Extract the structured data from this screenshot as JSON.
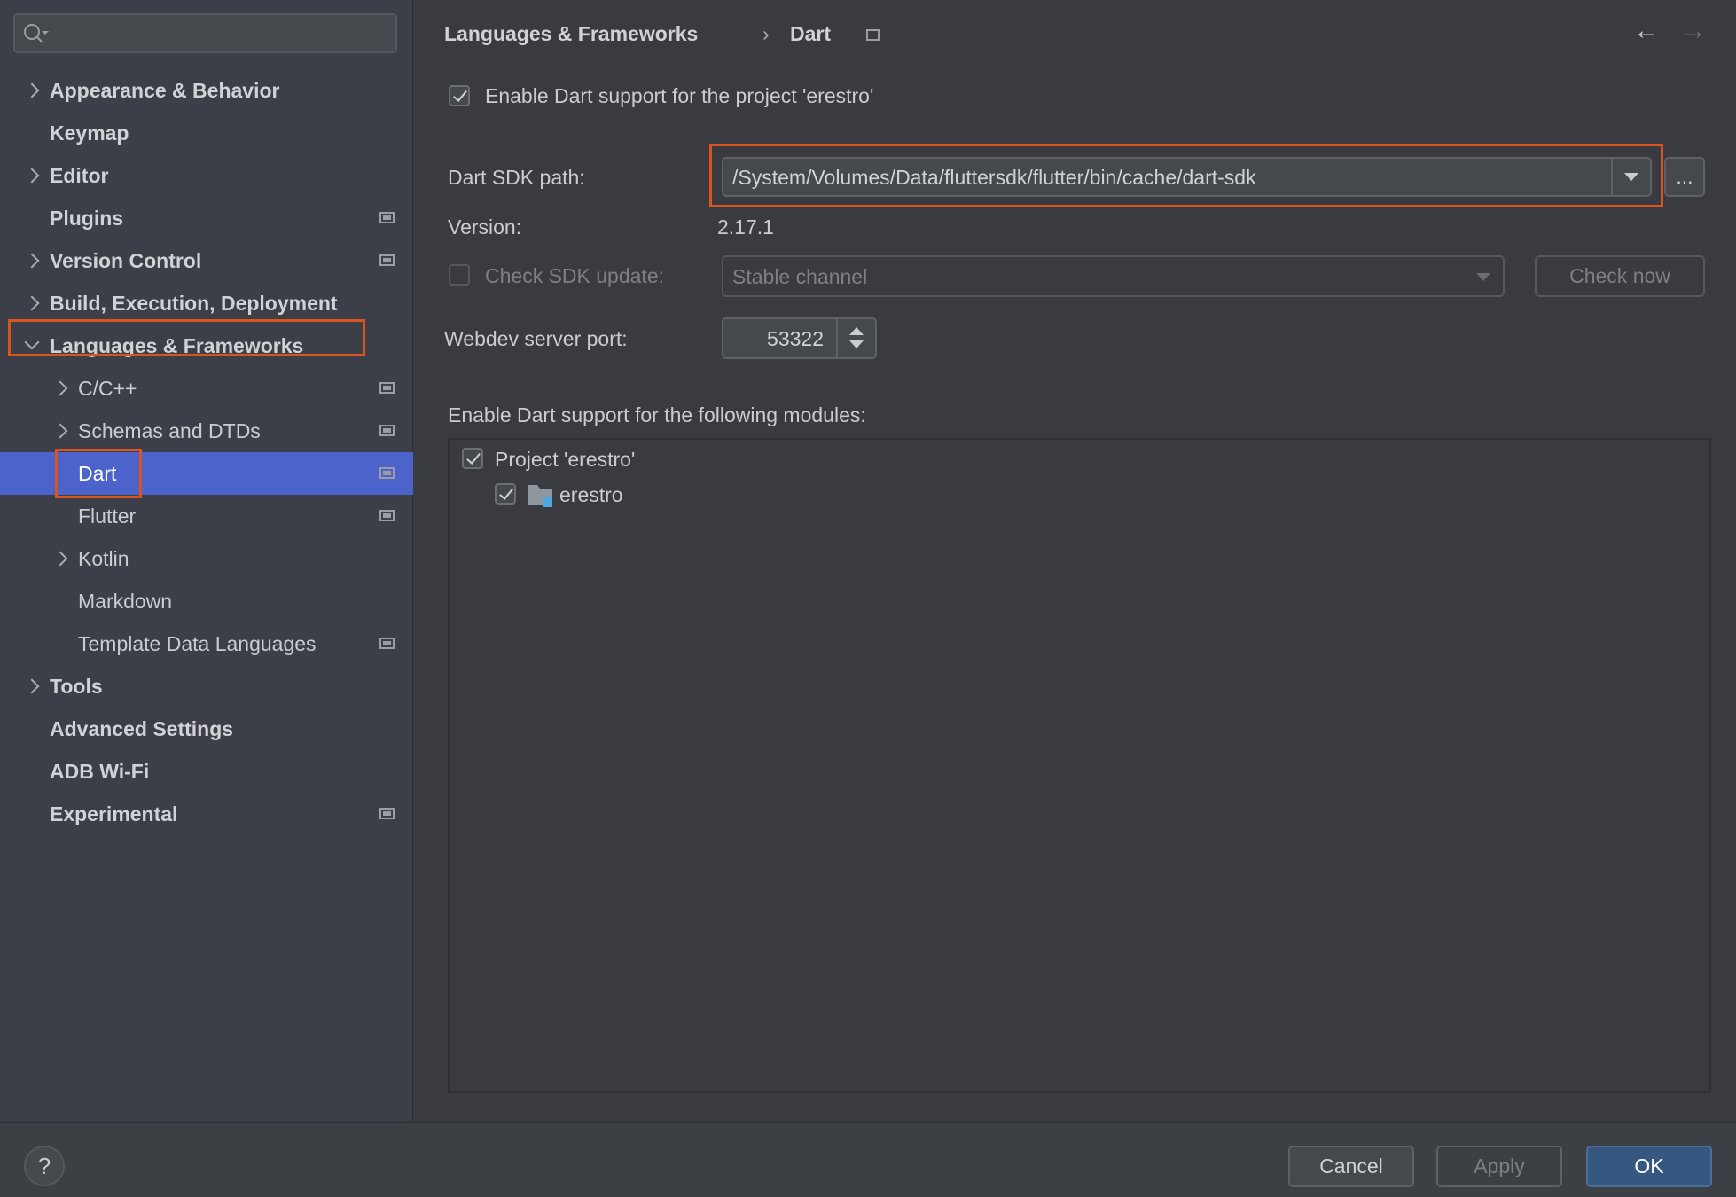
{
  "search": {
    "placeholder": ""
  },
  "sidebar": {
    "items": [
      {
        "label": "Appearance & Behavior",
        "level": 0,
        "bold": true,
        "chevron": "right",
        "settings": false
      },
      {
        "label": "Keymap",
        "level": 0,
        "bold": true,
        "chevron": null,
        "settings": false
      },
      {
        "label": "Editor",
        "level": 0,
        "bold": true,
        "chevron": "right",
        "settings": false
      },
      {
        "label": "Plugins",
        "level": 0,
        "bold": true,
        "chevron": null,
        "settings": true
      },
      {
        "label": "Version Control",
        "level": 0,
        "bold": true,
        "chevron": "right",
        "settings": true
      },
      {
        "label": "Build, Execution, Deployment",
        "level": 0,
        "bold": true,
        "chevron": "right",
        "settings": false
      },
      {
        "label": "Languages & Frameworks",
        "level": 0,
        "bold": true,
        "chevron": "down",
        "settings": false,
        "highlighted": true
      },
      {
        "label": "C/C++",
        "level": 1,
        "bold": false,
        "chevron": "right",
        "settings": true
      },
      {
        "label": "Schemas and DTDs",
        "level": 1,
        "bold": false,
        "chevron": "right",
        "settings": true
      },
      {
        "label": "Dart",
        "level": 1,
        "bold": false,
        "chevron": null,
        "settings": true,
        "selected": true,
        "highlighted": true
      },
      {
        "label": "Flutter",
        "level": 1,
        "bold": false,
        "chevron": null,
        "settings": true
      },
      {
        "label": "Kotlin",
        "level": 1,
        "bold": false,
        "chevron": "right",
        "settings": false
      },
      {
        "label": "Markdown",
        "level": 1,
        "bold": false,
        "chevron": null,
        "settings": false
      },
      {
        "label": "Template Data Languages",
        "level": 1,
        "bold": false,
        "chevron": null,
        "settings": true
      },
      {
        "label": "Tools",
        "level": 0,
        "bold": true,
        "chevron": "right",
        "settings": false
      },
      {
        "label": "Advanced Settings",
        "level": 0,
        "bold": true,
        "chevron": null,
        "settings": false
      },
      {
        "label": "ADB Wi-Fi",
        "level": 0,
        "bold": true,
        "chevron": null,
        "settings": false
      },
      {
        "label": "Experimental",
        "level": 0,
        "bold": true,
        "chevron": null,
        "settings": true
      }
    ]
  },
  "breadcrumb": {
    "parent": "Languages & Frameworks",
    "separator": "›",
    "current": "Dart"
  },
  "main": {
    "enable_project": {
      "label": "Enable Dart support for the project 'erestro'",
      "checked": true
    },
    "sdk_path": {
      "label": "Dart SDK path:",
      "value": "/System/Volumes/Data/fluttersdk/flutter/bin/cache/dart-sdk",
      "browse": "..."
    },
    "version": {
      "label": "Version:",
      "value": "2.17.1"
    },
    "check_update": {
      "label": "Check SDK update:",
      "checked": false,
      "channel": "Stable channel",
      "button": "Check now"
    },
    "webdev": {
      "label": "Webdev server port:",
      "value": "53322"
    },
    "modules": {
      "label": "Enable Dart support for the following modules:",
      "items": [
        {
          "label": "Project 'erestro'",
          "checked": true
        },
        {
          "label": "erestro",
          "checked": true
        }
      ]
    }
  },
  "footer": {
    "help": "?",
    "cancel": "Cancel",
    "apply": "Apply",
    "ok": "OK"
  },
  "colors": {
    "highlight": "#d9541e",
    "selection": "#4b63cb",
    "primary_button": "#365880"
  }
}
